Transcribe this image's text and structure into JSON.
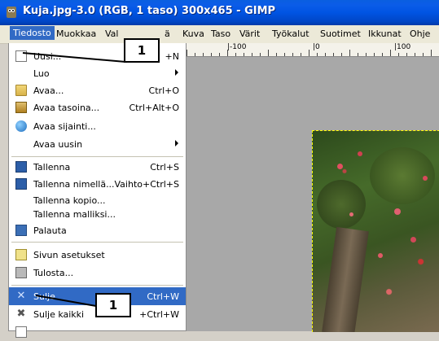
{
  "window": {
    "title": "Kuja.jpg-3.0 (RGB, 1 taso) 300x465 - GIMP"
  },
  "menubar": {
    "items": [
      "Tiedosto",
      "Muokkaa",
      "Val",
      "ä",
      "Kuva",
      "Taso",
      "Värit",
      "Työkalut",
      "Suotimet",
      "Ikkunat",
      "Ohje"
    ]
  },
  "ruler": {
    "labels": [
      "|-100",
      "|0",
      "|100"
    ]
  },
  "file_menu": {
    "items": [
      {
        "label": "Uusi...",
        "shortcut": "+N",
        "icon": "new-file-icon"
      },
      {
        "label": "Luo",
        "submenu": true
      },
      {
        "label": "Avaa...",
        "shortcut": "Ctrl+O",
        "icon": "open-folder-icon"
      },
      {
        "label": "Avaa tasoina...",
        "shortcut": "Ctrl+Alt+O",
        "icon": "open-as-layers-icon"
      },
      {
        "label": "Avaa sijainti...",
        "icon": "open-location-icon"
      },
      {
        "label": "Avaa uusin",
        "submenu": true
      },
      {
        "label": "Tallenna",
        "shortcut": "Ctrl+S",
        "icon": "save-icon"
      },
      {
        "label": "Tallenna nimellä...",
        "shortcut": "Vaihto+Ctrl+S",
        "icon": "save-as-icon"
      },
      {
        "label": "Tallenna kopio..."
      },
      {
        "label": "Tallenna malliksi..."
      },
      {
        "label": "Palauta",
        "icon": "revert-icon"
      },
      {
        "label": "Sivun asetukset",
        "icon": "page-setup-icon"
      },
      {
        "label": "Tulosta...",
        "icon": "print-icon"
      },
      {
        "label": "Sulje",
        "shortcut": "Ctrl+W",
        "icon": "close-icon",
        "highlighted": true
      },
      {
        "label": "Sulje kaikki",
        "shortcut": "+Ctrl+W",
        "icon": "close-all-icon"
      }
    ]
  },
  "callouts": {
    "top": "1",
    "bottom": "1"
  },
  "colors": {
    "title_bar": "#0054e3",
    "highlight": "#316ac5",
    "menubar": "#ece9d8"
  }
}
